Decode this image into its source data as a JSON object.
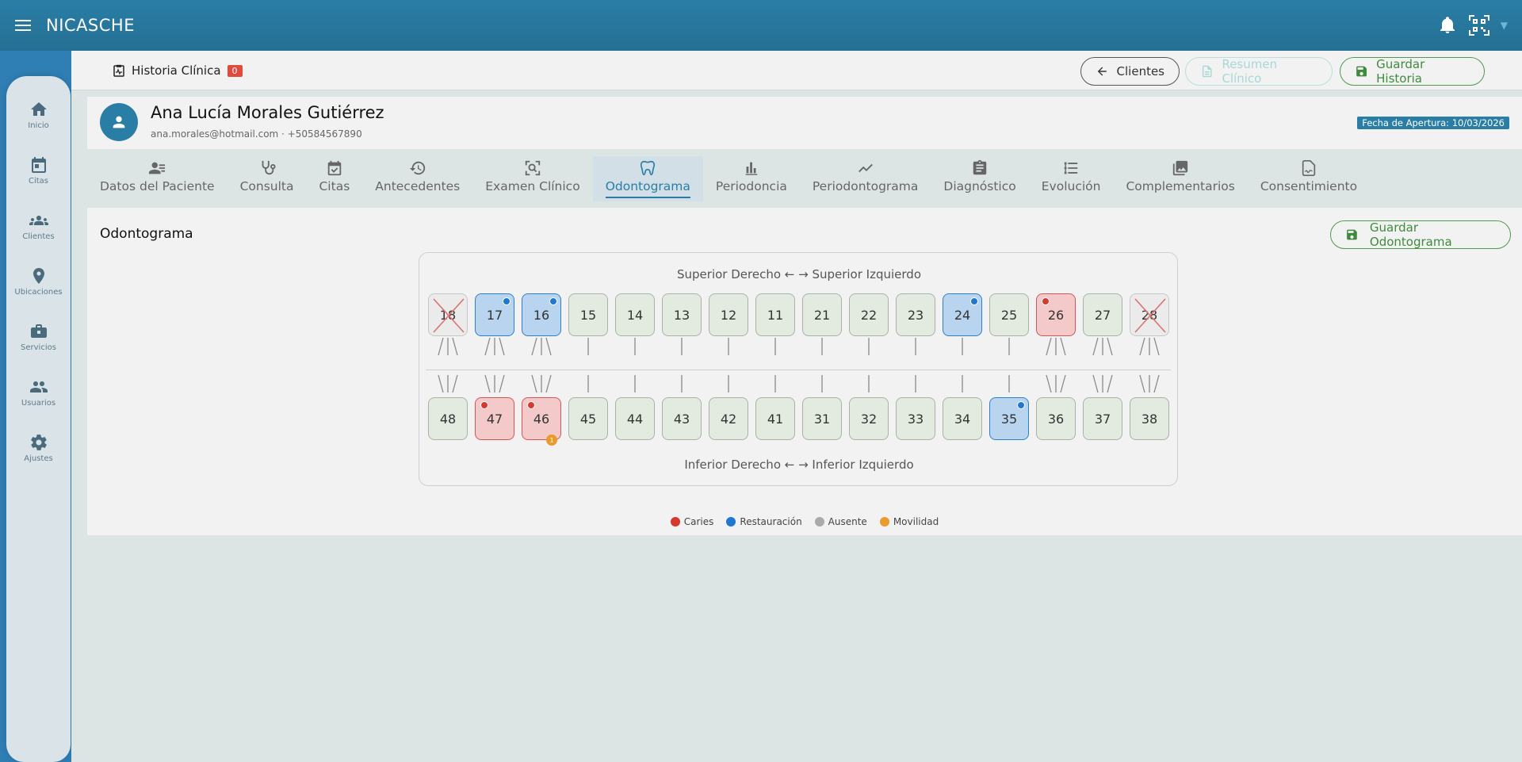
{
  "app": {
    "title": "NICASCHE"
  },
  "sidebar": {
    "items": [
      {
        "label": "Inicio",
        "icon": "home-icon"
      },
      {
        "label": "Citas",
        "icon": "calendar-icon"
      },
      {
        "label": "Clientes",
        "icon": "group-icon"
      },
      {
        "label": "Ubicaciones",
        "icon": "location-pin-icon"
      },
      {
        "label": "Servicios",
        "icon": "briefcase-icon"
      },
      {
        "label": "Usuarios",
        "icon": "users-icon"
      },
      {
        "label": "Ajustes",
        "icon": "gear-icon"
      }
    ]
  },
  "header": {
    "section_title": "Historia Clínica",
    "count": "0",
    "back_label": "Clientes",
    "summary_label": "Resumen Clínico",
    "save_label": "Guardar Historia"
  },
  "patient": {
    "name": "Ana Lucía Morales Gutiérrez",
    "contact": "ana.morales@hotmail.com · +50584567890",
    "opening_date": "Fecha de Apertura: 10/03/2026"
  },
  "tabs": [
    {
      "label": "Datos del Paciente",
      "icon": "patient-list-icon",
      "active": false
    },
    {
      "label": "Consulta",
      "icon": "stethoscope-icon",
      "active": false
    },
    {
      "label": "Citas",
      "icon": "calendar-check-icon",
      "active": false
    },
    {
      "label": "Antecedentes",
      "icon": "history-icon",
      "active": false
    },
    {
      "label": "Examen Clínico",
      "icon": "scan-icon",
      "active": false
    },
    {
      "label": "Odontograma",
      "icon": "tooth-icon",
      "active": true
    },
    {
      "label": "Periodoncia",
      "icon": "bar-chart-icon",
      "active": false
    },
    {
      "label": "Periodontograma",
      "icon": "line-chart-icon",
      "active": false
    },
    {
      "label": "Diagnóstico",
      "icon": "clipboard-icon",
      "active": false
    },
    {
      "label": "Evolución",
      "icon": "timeline-icon",
      "active": false
    },
    {
      "label": "Complementarios",
      "icon": "images-icon",
      "active": false
    },
    {
      "label": "Consentimiento",
      "icon": "signature-doc-icon",
      "active": false
    }
  ],
  "odontograma": {
    "title": "Odontograma",
    "save_label": "Guardar Odontograma",
    "upper_label": "Superior Derecho ← → Superior Izquierdo",
    "lower_label": "Inferior Derecho ← → Inferior Izquierdo",
    "upper": [
      {
        "n": "18",
        "state": "absent",
        "roots": 3
      },
      {
        "n": "17",
        "state": "rest",
        "roots": 3
      },
      {
        "n": "16",
        "state": "rest",
        "roots": 3
      },
      {
        "n": "15",
        "state": "normal",
        "roots": 1
      },
      {
        "n": "14",
        "state": "normal",
        "roots": 1
      },
      {
        "n": "13",
        "state": "normal",
        "roots": 1
      },
      {
        "n": "12",
        "state": "normal",
        "roots": 1
      },
      {
        "n": "11",
        "state": "normal",
        "roots": 1
      },
      {
        "n": "21",
        "state": "normal",
        "roots": 1
      },
      {
        "n": "22",
        "state": "normal",
        "roots": 1
      },
      {
        "n": "23",
        "state": "normal",
        "roots": 1
      },
      {
        "n": "24",
        "state": "rest",
        "roots": 1
      },
      {
        "n": "25",
        "state": "normal",
        "roots": 1
      },
      {
        "n": "26",
        "state": "caries",
        "roots": 3
      },
      {
        "n": "27",
        "state": "normal",
        "roots": 3
      },
      {
        "n": "28",
        "state": "absent",
        "roots": 3
      }
    ],
    "lower": [
      {
        "n": "48",
        "state": "normal",
        "roots": 3
      },
      {
        "n": "47",
        "state": "caries",
        "roots": 3
      },
      {
        "n": "46",
        "state": "caries",
        "roots": 3,
        "mobility": "1"
      },
      {
        "n": "45",
        "state": "normal",
        "roots": 1
      },
      {
        "n": "44",
        "state": "normal",
        "roots": 1
      },
      {
        "n": "43",
        "state": "normal",
        "roots": 1
      },
      {
        "n": "42",
        "state": "normal",
        "roots": 1
      },
      {
        "n": "41",
        "state": "normal",
        "roots": 1
      },
      {
        "n": "31",
        "state": "normal",
        "roots": 1
      },
      {
        "n": "32",
        "state": "normal",
        "roots": 1
      },
      {
        "n": "33",
        "state": "normal",
        "roots": 1
      },
      {
        "n": "34",
        "state": "normal",
        "roots": 1
      },
      {
        "n": "35",
        "state": "rest",
        "roots": 1
      },
      {
        "n": "36",
        "state": "normal",
        "roots": 3
      },
      {
        "n": "37",
        "state": "normal",
        "roots": 3
      },
      {
        "n": "38",
        "state": "normal",
        "roots": 3
      }
    ],
    "legend": [
      {
        "label": "Caries",
        "color": "#d63a2f"
      },
      {
        "label": "Restauración",
        "color": "#1f77d0"
      },
      {
        "label": "Ausente",
        "color": "#aaaaaa"
      },
      {
        "label": "Movilidad",
        "color": "#e99b2c"
      }
    ]
  },
  "colors": {
    "primary": "#2a7ea6",
    "success": "#3f8a3f",
    "danger": "#e24b3b"
  }
}
